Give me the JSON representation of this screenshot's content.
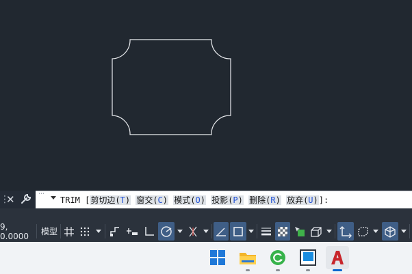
{
  "command": {
    "name": "TRIM",
    "open_bracket": "[",
    "options": [
      {
        "label": "剪切边(",
        "key": "T",
        "end": ")"
      },
      {
        "label": "窗交(",
        "key": "C",
        "end": ")"
      },
      {
        "label": "模式(",
        "key": "O",
        "end": ")"
      },
      {
        "label": "投影(",
        "key": "P",
        "end": ")"
      },
      {
        "label": "删除(",
        "key": "R",
        "end": ")"
      },
      {
        "label": "放弃(",
        "key": "U",
        "end": ")"
      }
    ],
    "close": "]:"
  },
  "status": {
    "coords": "9, 0.0000",
    "model_label": "模型"
  },
  "icons": {
    "close": "close-icon",
    "customize": "wrench-icon",
    "grid": "grid-icon",
    "snap": "snap-dots-icon",
    "ortho": "ortho-icon",
    "polar": "polar-tracking-icon",
    "osnap": "object-snap-icon",
    "lineweight": "lineweight-icon",
    "transparency": "transparency-icon",
    "annotation": "annotation-monitor-icon",
    "workspace": "workspace-icon"
  },
  "taskbar": {
    "apps": [
      "windows-start",
      "file-explorer",
      "browser",
      "app",
      "autocad"
    ],
    "active": "autocad"
  },
  "colors": {
    "canvas": "#212830",
    "geometry": "#e8eaed",
    "active_toggle": "#3f5e86",
    "option_key": "#1d4fd6"
  }
}
